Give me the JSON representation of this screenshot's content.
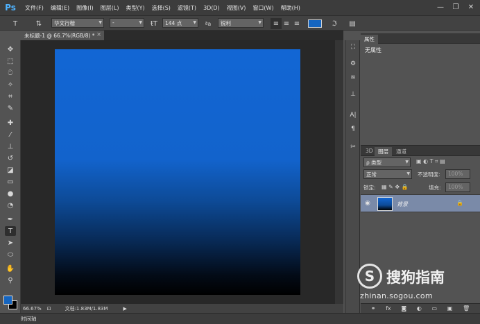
{
  "app": {
    "logo_text": "Ps"
  },
  "menu": [
    "文件(F)",
    "编辑(E)",
    "图像(I)",
    "图层(L)",
    "类型(Y)",
    "选择(S)",
    "滤镜(T)",
    "3D(D)",
    "视图(V)",
    "窗口(W)",
    "帮助(H)"
  ],
  "window_controls": {
    "minimize": "—",
    "restore": "❐",
    "close": "✕"
  },
  "options_bar": {
    "font_family": "华文行楷",
    "font_style": "-",
    "font_size": "144 点",
    "aa_label": "ªa",
    "anti_alias": "锐利",
    "text_color": "#1565c0"
  },
  "document": {
    "tab_title": "未标题-1 @ 66.7%(RGB/8) *",
    "close_glyph": "×"
  },
  "canvas": {
    "gradient_top": "#1266d4",
    "gradient_bottom": "#000000"
  },
  "status": {
    "zoom": "66.67%",
    "doc_info": "文档:1.83M/1.83M"
  },
  "timeline": {
    "label": "时间轴"
  },
  "properties_panel": {
    "tab": "属性",
    "body": "无属性"
  },
  "layers_panel": {
    "tabs": [
      "3D",
      "图层",
      "通道"
    ],
    "filter_label": "ρ 类型",
    "blend_mode": "正常",
    "opacity_label": "不透明度:",
    "opacity_value": "100%",
    "lock_label": "锁定:",
    "fill_label": "填充:",
    "fill_value": "100%",
    "layers": [
      {
        "name": "背景",
        "visible": true,
        "locked": true
      }
    ]
  },
  "colors": {
    "foreground": "#1565c0",
    "background": "#000000"
  },
  "watermark": {
    "title": "搜狗指南",
    "url": "zhinan.sogou.com",
    "logo_glyph": "S"
  }
}
